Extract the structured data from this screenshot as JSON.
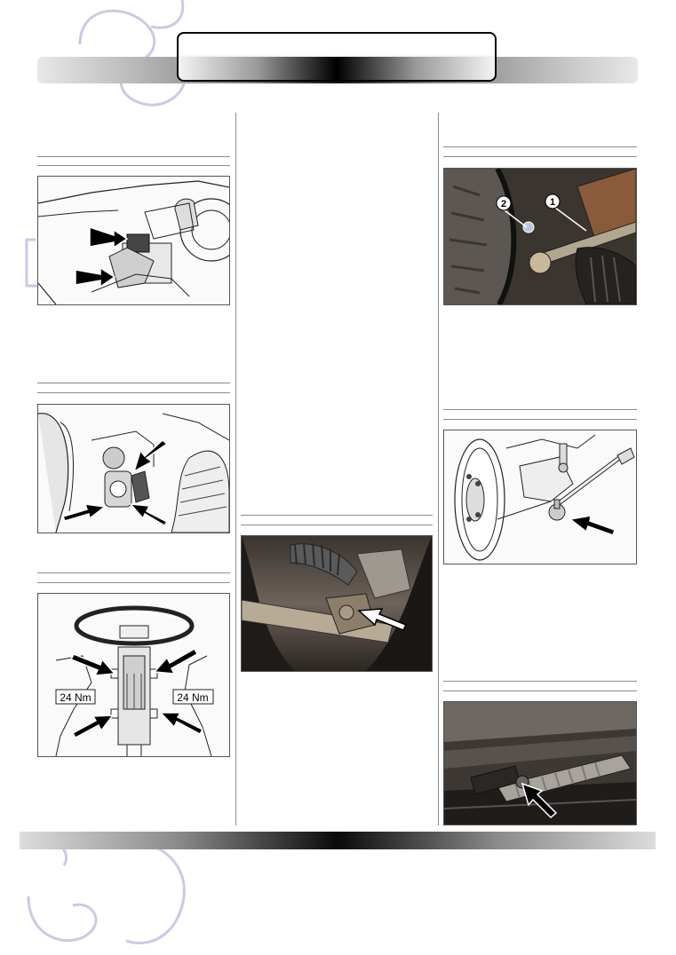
{
  "header": {
    "title_box": ""
  },
  "figures": [
    {
      "id": "fig-1",
      "caption": ""
    },
    {
      "id": "fig-2",
      "caption": ""
    },
    {
      "id": "fig-3",
      "caption": "",
      "torque_left": "24 Nm",
      "torque_right": "24 Nm"
    },
    {
      "id": "fig-4",
      "caption": ""
    },
    {
      "id": "fig-5",
      "caption": "",
      "callout_1": "1",
      "callout_2": "2"
    },
    {
      "id": "fig-6",
      "caption": ""
    },
    {
      "id": "fig-7",
      "caption": ""
    }
  ],
  "colors": {
    "watermark": "#c9c9e8",
    "rule": "#8c8c8c",
    "arrow": "#000000"
  }
}
